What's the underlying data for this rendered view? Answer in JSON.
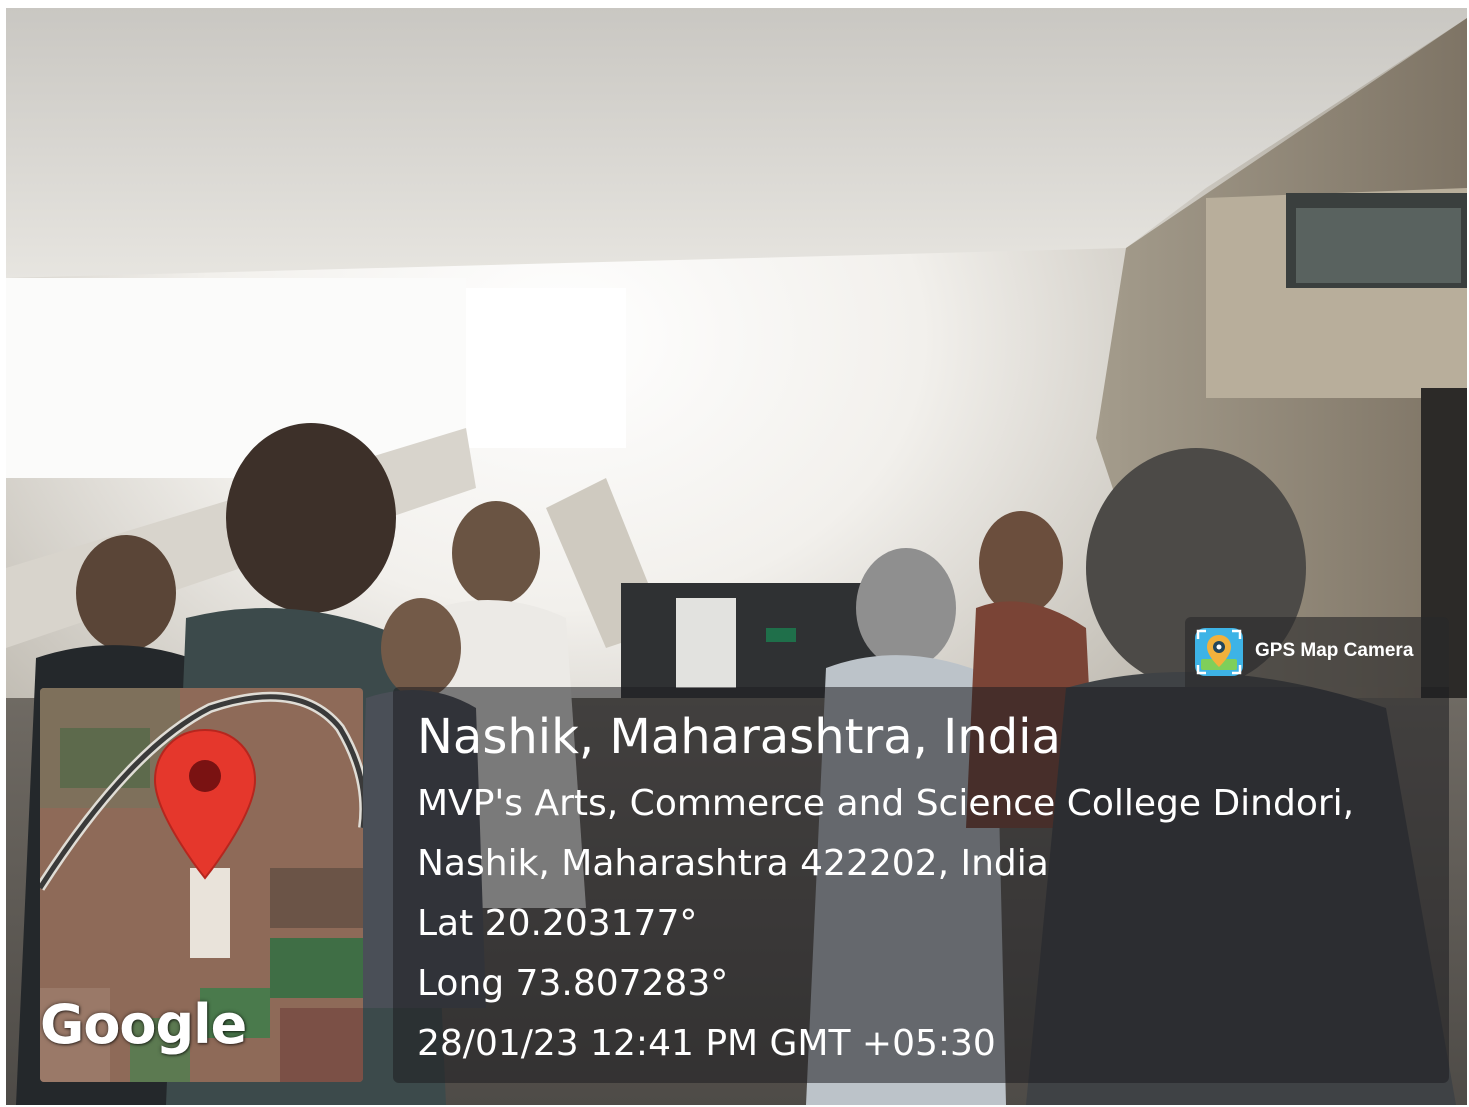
{
  "overlay": {
    "app_badge": {
      "label": "GPS Map Camera",
      "icon": "gps-map-camera-app-icon"
    },
    "map": {
      "logo_text": "Google",
      "pin_icon": "map-pin-icon",
      "pin_color": "#e5372c"
    },
    "location": {
      "title": "Nashik, Maharashtra, India",
      "address_line1": "MVP's Arts, Commerce and Science College Dindori,",
      "address_line2": "Nashik, Maharashtra 422202, India",
      "latitude": "Lat 20.203177°",
      "longitude": "Long 73.807283°",
      "datetime": "28/01/23 12:41 PM GMT +05:30"
    }
  }
}
